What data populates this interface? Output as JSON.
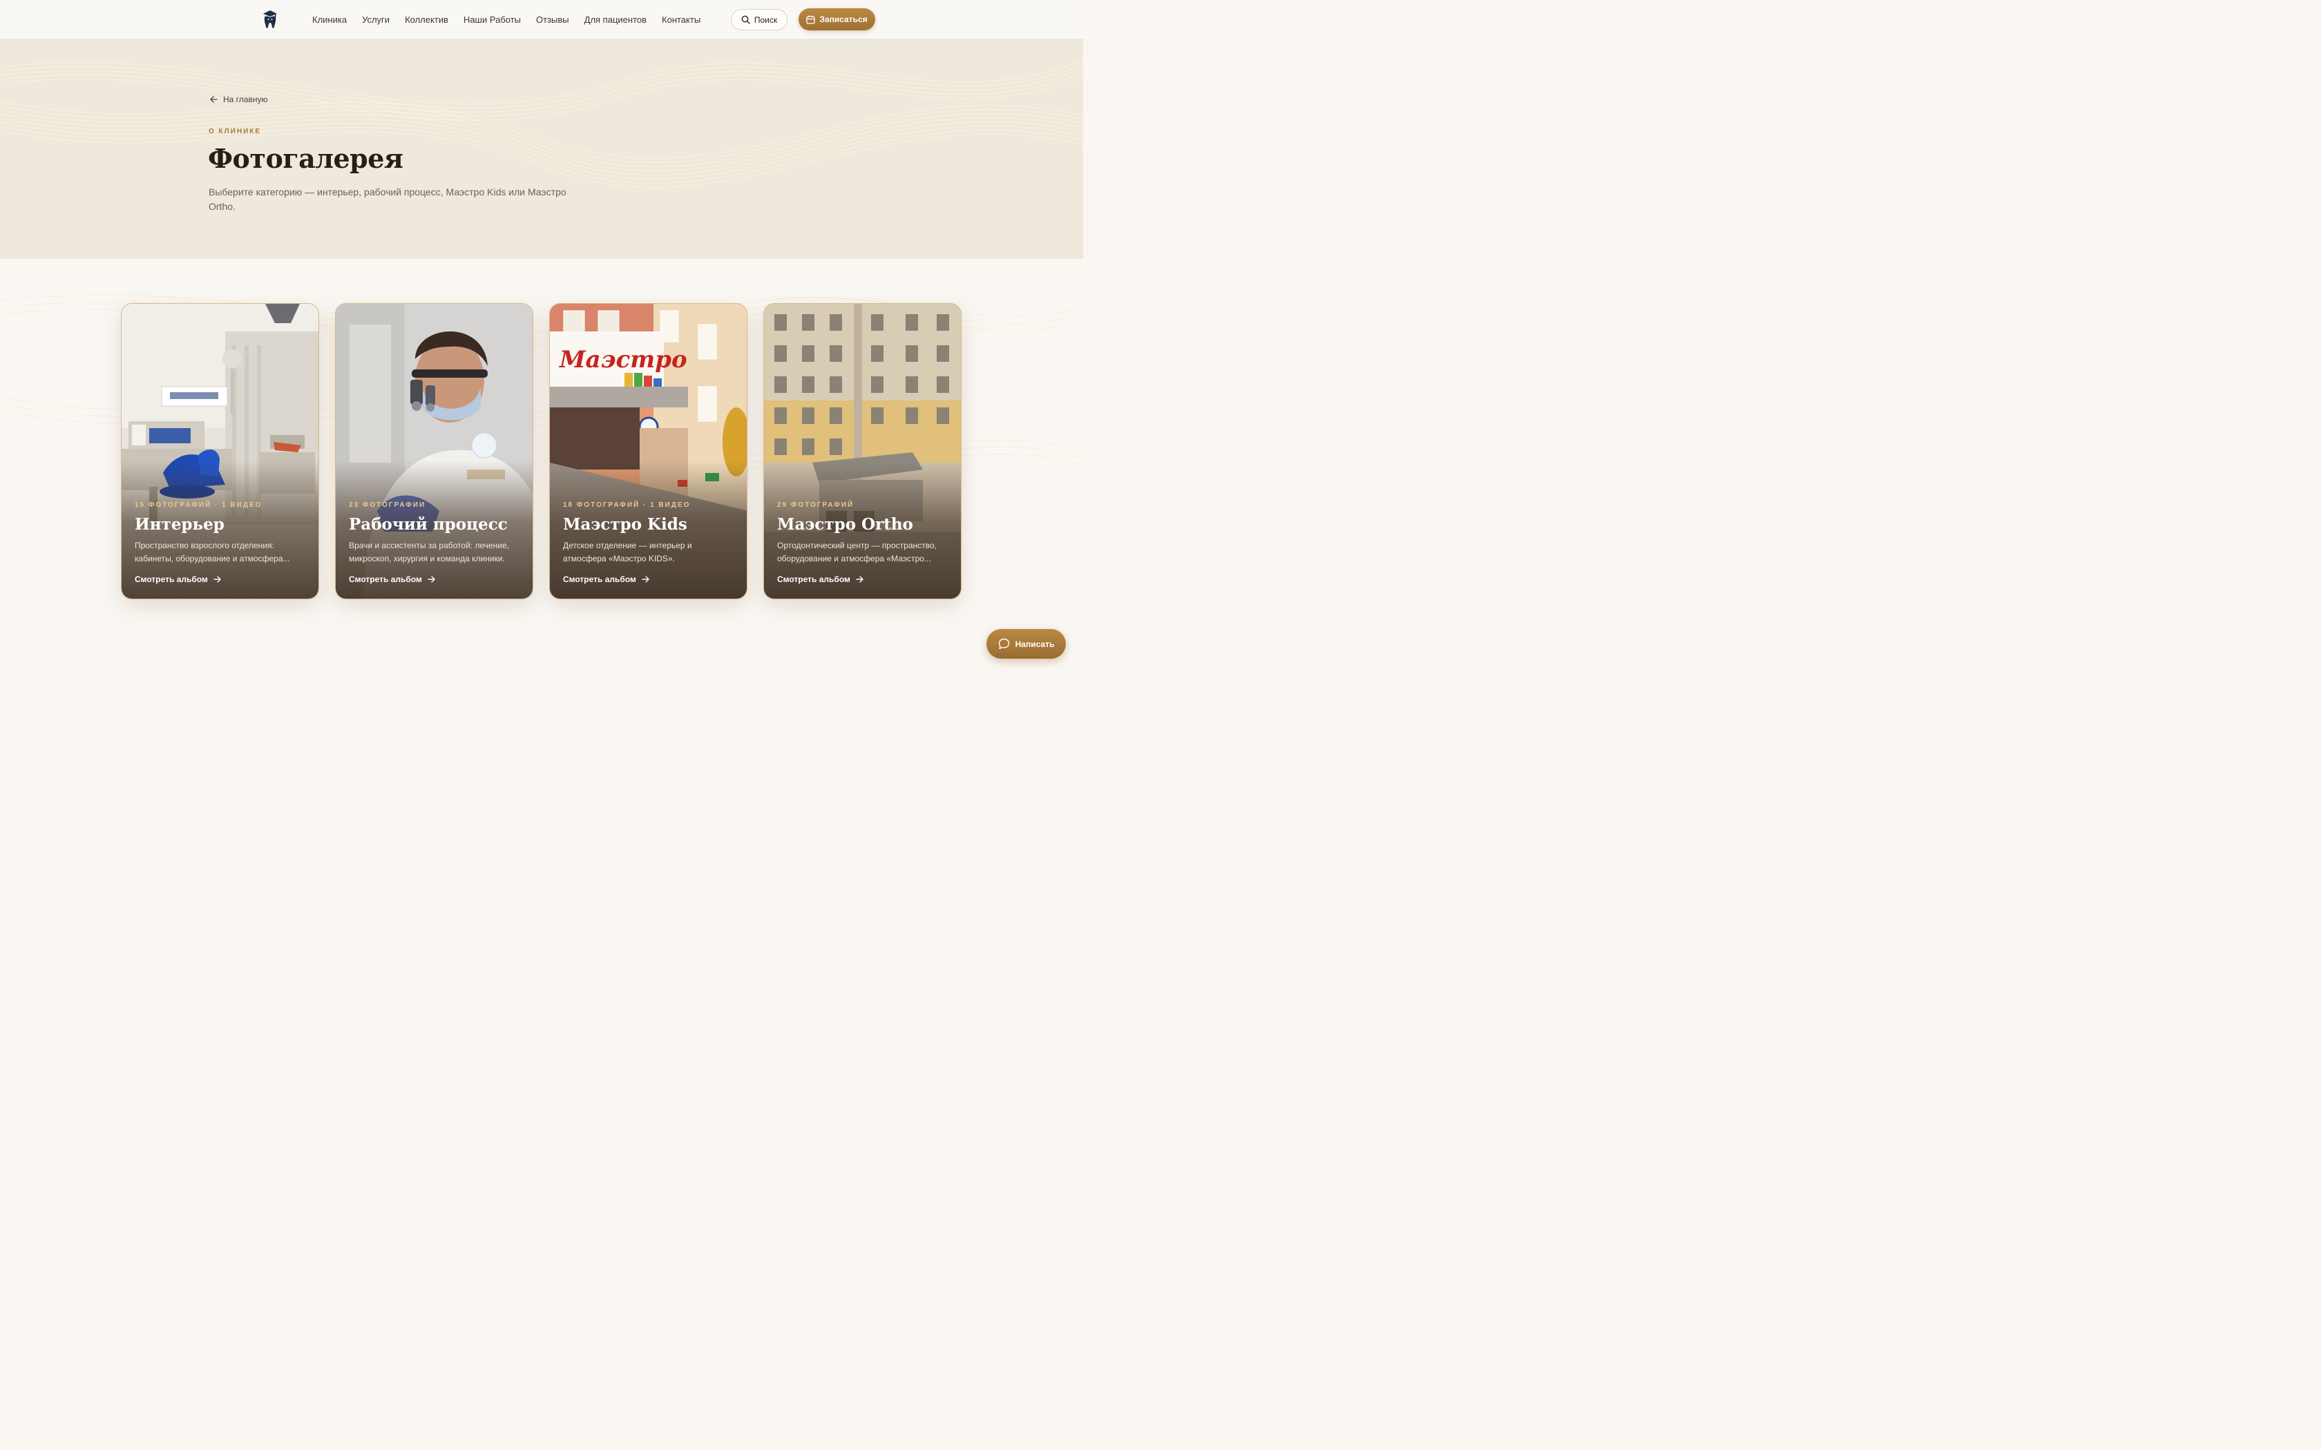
{
  "header": {
    "logo_icon": "tooth-graduate-icon",
    "nav": [
      "Клиника",
      "Услуги",
      "Коллектив",
      "Наши Работы",
      "Отзывы",
      "Для пациентов",
      "Контакты"
    ],
    "search_label": "Поиск",
    "cta_label": "Записаться"
  },
  "hero": {
    "back_label": "На главную",
    "eyebrow": "О КЛИНИКЕ",
    "title": "Фотогалерея",
    "subtitle": "Выберите категорию — интерьер, рабочий процесс, Маэстро Kids или Маэстро Ortho."
  },
  "cards": [
    {
      "meta": "15 ФОТОГРАФИЙ · 1 ВИДЕО",
      "title": "Интерьер",
      "desc": "Пространство взрослого отделения: кабинеты, оборудование и атмосфера...",
      "link": "Смотреть альбом"
    },
    {
      "meta": "23 ФОТОГРАФИИ",
      "title": "Рабочий процесс",
      "desc": "Врачи и ассистенты за работой: лечение, микроскоп, хирургия и команда клиники.",
      "link": "Смотреть альбом"
    },
    {
      "meta": "18 ФОТОГРАФИЙ · 1 ВИДЕО",
      "title": "Маэстро Kids",
      "desc": "Детское отделение — интерьер и атмосфера «Маэстро KIDS».",
      "link": "Смотреть альбом"
    },
    {
      "meta": "29 ФОТОГРАФИЙ",
      "title": "Маэстро Ortho",
      "desc": "Ортодонтический центр — пространство, оборудование и атмосфера «Маэстро...",
      "link": "Смотреть альбом"
    }
  ],
  "chat": {
    "label": "Написать"
  },
  "colors": {
    "accent": "#a87a3d",
    "accent_dark": "#9e7034",
    "hero_bg": "#efe8dd",
    "page_bg": "#faf7f3"
  }
}
